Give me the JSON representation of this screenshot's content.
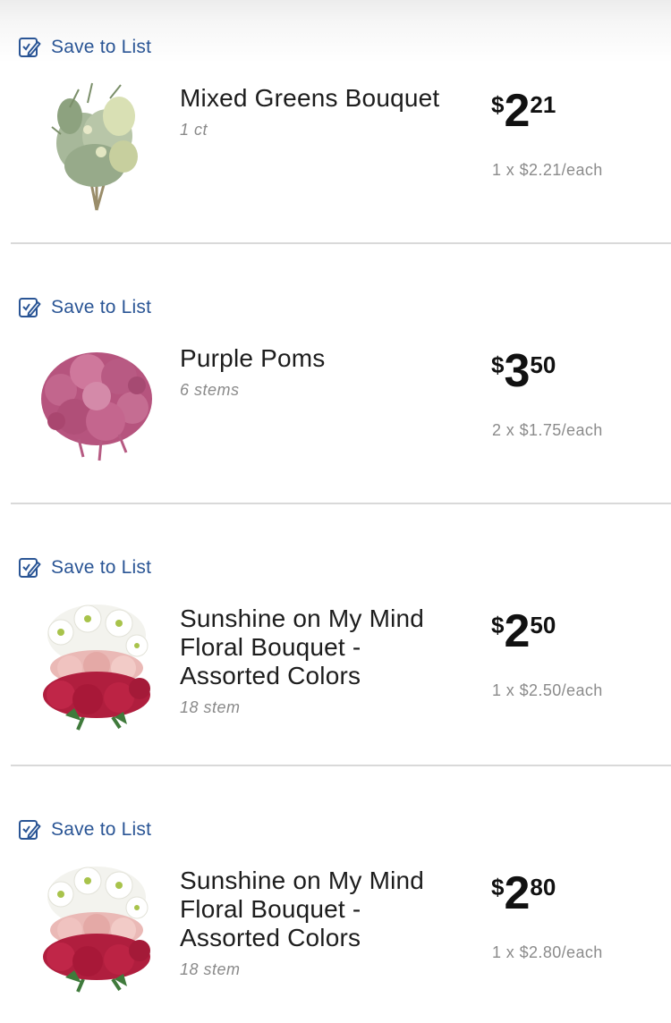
{
  "items": [
    {
      "save_label": "Save to List",
      "name": "Mixed Greens Bouquet",
      "size": "1 ct",
      "price_currency": "$",
      "price_dollars": "2",
      "price_cents": "21",
      "unit_price": "1 x $2.21/each",
      "image_icon": "mixed-greens-bouquet-photo"
    },
    {
      "save_label": "Save to List",
      "name": "Purple Poms",
      "size": "6 stems",
      "price_currency": "$",
      "price_dollars": "3",
      "price_cents": "50",
      "unit_price": "2 x $1.75/each",
      "image_icon": "purple-poms-photo"
    },
    {
      "save_label": "Save to List",
      "name": "Sunshine on My Mind Floral Bouquet - Assorted Colors",
      "size": "18 stem",
      "price_currency": "$",
      "price_dollars": "2",
      "price_cents": "50",
      "unit_price": "1 x $2.50/each",
      "image_icon": "sunshine-bouquet-photo"
    },
    {
      "save_label": "Save to List",
      "name": "Sunshine on My Mind Floral Bouquet - Assorted Colors",
      "size": "18 stem",
      "price_currency": "$",
      "price_dollars": "2",
      "price_cents": "80",
      "unit_price": "1 x $2.80/each",
      "image_icon": "sunshine-bouquet-photo"
    }
  ],
  "colors": {
    "link": "#2a5595",
    "divider": "#d9d9d9",
    "muted_text": "#8b8b8b"
  }
}
